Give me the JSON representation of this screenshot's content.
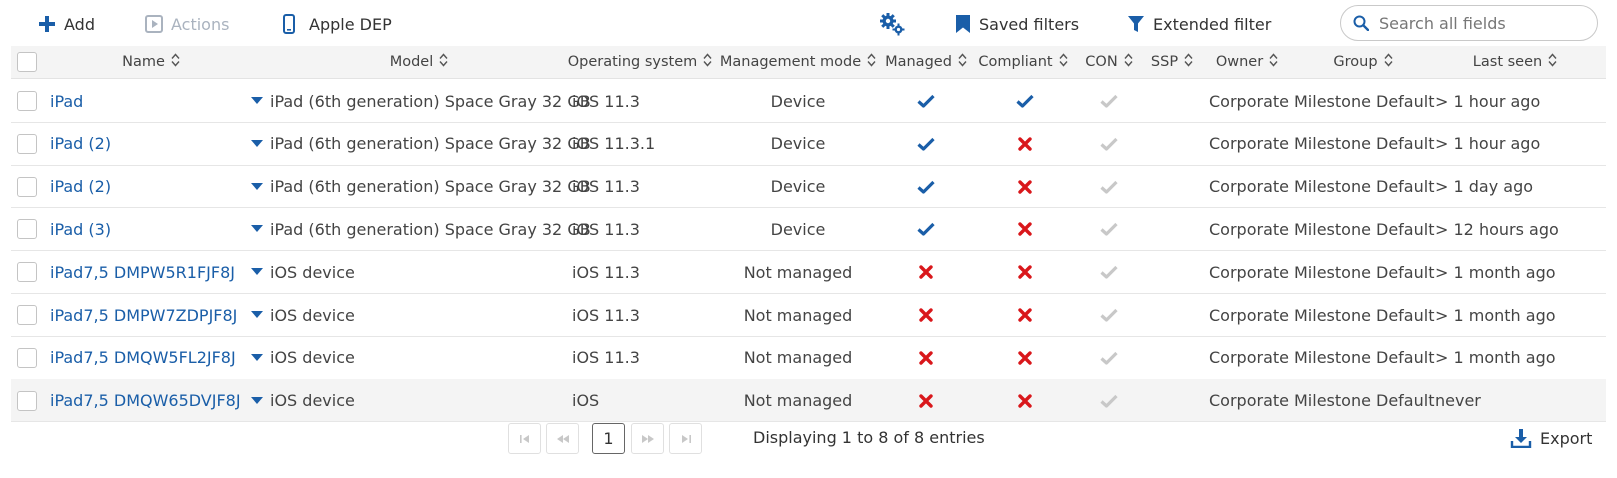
{
  "toolbar": {
    "add_label": "Add",
    "actions_label": "Actions",
    "apple_dep_label": "Apple DEP",
    "saved_filters_label": "Saved filters",
    "extended_filter_label": "Extended filter",
    "search_placeholder": "Search all fields"
  },
  "table": {
    "columns": [
      "Name",
      "Model",
      "Operating system",
      "Management mode",
      "Managed",
      "Compliant",
      "CON",
      "SSP",
      "Owner",
      "Group",
      "Last seen"
    ],
    "rows": [
      {
        "name": "iPad",
        "model": "iPad (6th generation) Space Gray 32 GB",
        "os": "iOS 11.3",
        "mode": "Device",
        "managed": true,
        "compliant": true,
        "owner": "Corporate",
        "group": "Milestone Default",
        "last_seen": "> 1 hour ago"
      },
      {
        "name": "iPad (2)",
        "model": "iPad (6th generation) Space Gray 32 GB",
        "os": "iOS 11.3.1",
        "mode": "Device",
        "managed": true,
        "compliant": false,
        "owner": "Corporate",
        "group": "Milestone Default",
        "last_seen": "> 1 hour ago"
      },
      {
        "name": "iPad (2)",
        "model": "iPad (6th generation) Space Gray 32 GB",
        "os": "iOS 11.3",
        "mode": "Device",
        "managed": true,
        "compliant": false,
        "owner": "Corporate",
        "group": "Milestone Default",
        "last_seen": "> 1 day ago"
      },
      {
        "name": "iPad (3)",
        "model": "iPad (6th generation) Space Gray 32 GB",
        "os": "iOS 11.3",
        "mode": "Device",
        "managed": true,
        "compliant": false,
        "owner": "Corporate",
        "group": "Milestone Default",
        "last_seen": "> 12 hours ago"
      },
      {
        "name": "iPad7,5 DMPW5R1FJF8J",
        "model": "iOS device",
        "os": "iOS 11.3",
        "mode": "Not managed",
        "managed": false,
        "compliant": false,
        "owner": "Corporate",
        "group": "Milestone Default",
        "last_seen": "> 1 month ago"
      },
      {
        "name": "iPad7,5 DMPW7ZDPJF8J",
        "model": "iOS device",
        "os": "iOS 11.3",
        "mode": "Not managed",
        "managed": false,
        "compliant": false,
        "owner": "Corporate",
        "group": "Milestone Default",
        "last_seen": "> 1 month ago"
      },
      {
        "name": "iPad7,5 DMQW5FL2JF8J",
        "model": "iOS device",
        "os": "iOS 11.3",
        "mode": "Not managed",
        "managed": false,
        "compliant": false,
        "owner": "Corporate",
        "group": "Milestone Default",
        "last_seen": "> 1 month ago"
      },
      {
        "name": "iPad7,5 DMQW65DVJF8J",
        "model": "iOS device",
        "os": "iOS",
        "mode": "Not managed",
        "managed": false,
        "compliant": false,
        "owner": "Corporate",
        "group": "Milestone Default",
        "last_seen": "never"
      }
    ]
  },
  "pagination": {
    "current_page": "1",
    "summary": "Displaying 1 to 8 of 8 entries"
  },
  "footer": {
    "export_label": "Export"
  },
  "colors": {
    "accent": "#1a5ea8",
    "error": "#d9171b",
    "muted_check": "#c8c8c8"
  }
}
